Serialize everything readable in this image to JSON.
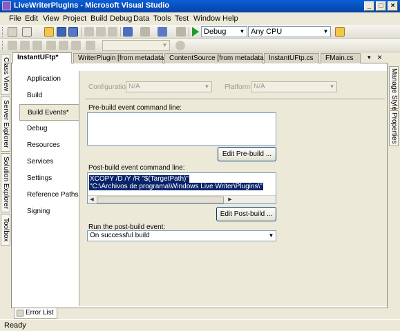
{
  "window": {
    "title": "LiveWriterPlugIns - Microsoft Visual Studio"
  },
  "menu": [
    "File",
    "Edit",
    "View",
    "Project",
    "Build",
    "Debug",
    "Data",
    "Tools",
    "Test",
    "Window",
    "Help"
  ],
  "toolbar": {
    "config_value": "Debug",
    "platform_value": "Any CPU"
  },
  "side_tabs": {
    "left": [
      "Class View",
      "Server Explorer",
      "Solution Explorer",
      "Toolbox"
    ],
    "right": [
      "Manage Styles",
      "Properties"
    ]
  },
  "doc_tabs": [
    "InstantUFtp*",
    "WriterPlugin [from metadata]",
    "ContentSource [from metadata]",
    "InstantUFtp.cs",
    "FMain.cs"
  ],
  "nav": [
    "Application",
    "Build",
    "Build Events*",
    "Debug",
    "Resources",
    "Services",
    "Settings",
    "Reference Paths",
    "Signing"
  ],
  "props": {
    "configuration_label": "Configuration:",
    "configuration_value": "N/A",
    "platform_label": "Platform:",
    "platform_value": "N/A",
    "prebuild_label": "Pre-build event command line:",
    "edit_prebuild": "Edit Pre-build ...",
    "postbuild_label": "Post-build event command line:",
    "postbuild_lines": [
      "XCOPY /D /Y /R \"$(TargetPath)\"",
      "\"C:\\Archivos de programa\\Windows Live Writer\\Plugins\\\""
    ],
    "edit_postbuild": "Edit Post-build ...",
    "run_label": "Run the post-build event:",
    "run_value": "On successful build"
  },
  "bottom_tabs": [
    "Error List"
  ],
  "status": "Ready"
}
